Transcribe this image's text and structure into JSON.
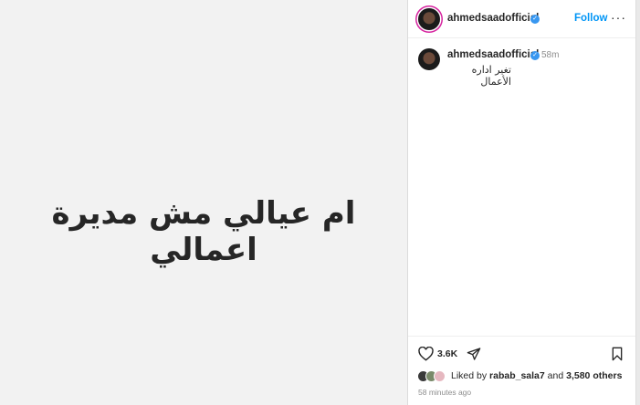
{
  "post": {
    "image_text": "ام عيالي مش مديرة اعمالي"
  },
  "header": {
    "username": "ahmedsaadofficial",
    "verified_icon": "verified-badge-icon",
    "follow_label": "Follow",
    "more_icon": "more-options-icon"
  },
  "caption": {
    "username": "ahmedsaadofficial",
    "time": "58m",
    "text": "تغير اداره الأعمال"
  },
  "actions": {
    "like_icon": "heart-icon",
    "like_count": "3.6K",
    "share_icon": "share-icon",
    "save_icon": "bookmark-icon"
  },
  "likes": {
    "prefix": "Liked by",
    "first_user": "rabab_sala7",
    "middle": "and",
    "others": "3,580 others"
  },
  "timestamp": "58 minutes ago",
  "colors": {
    "accent": "#0095f6",
    "verified": "#3897f0",
    "media_background": "#f2f2f2"
  }
}
